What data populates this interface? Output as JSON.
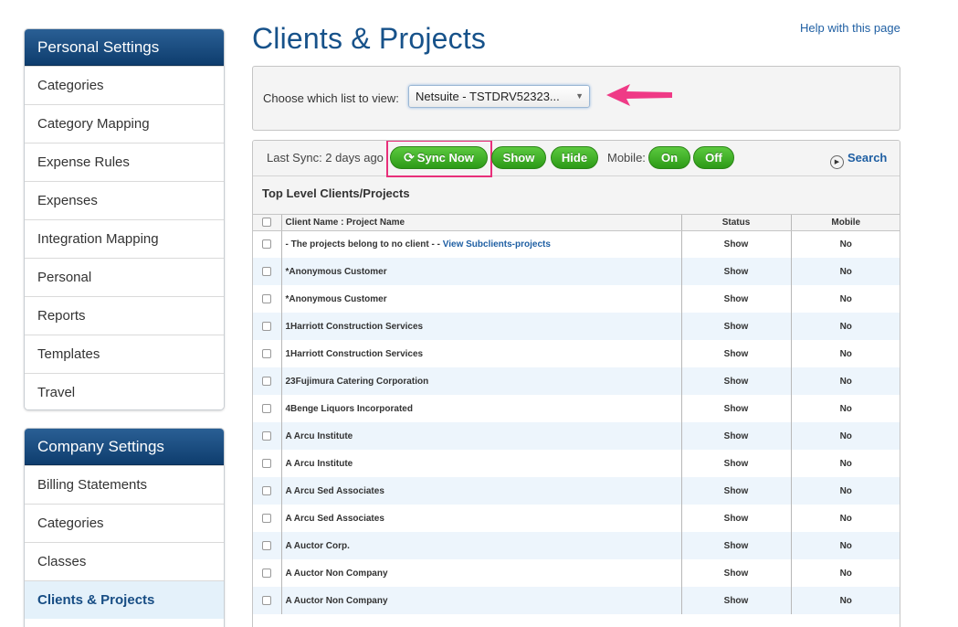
{
  "personal": {
    "title": "Personal Settings",
    "items": [
      "Categories",
      "Category Mapping",
      "Expense Rules",
      "Expenses",
      "Integration Mapping",
      "Personal",
      "Reports",
      "Templates",
      "Travel"
    ]
  },
  "company": {
    "title": "Company Settings",
    "items": [
      "Billing Statements",
      "Categories",
      "Classes",
      "Clients & Projects"
    ],
    "active": "Clients & Projects"
  },
  "header": {
    "title": "Clients & Projects",
    "help": "Help with this page"
  },
  "chooser": {
    "label": "Choose which list to view:",
    "selected": "Netsuite - TSTDRV52323..."
  },
  "toolbar": {
    "last_sync": "Last Sync: 2 days ago",
    "sync_now": "Sync Now",
    "show": "Show",
    "hide": "Hide",
    "mobile_label": "Mobile:",
    "on": "On",
    "off": "Off",
    "search": "Search"
  },
  "colors": {
    "accent": "#17528a",
    "button_green": "#2c9a17",
    "highlight": "#e8307a"
  },
  "table": {
    "section_title": "Top Level Clients/Projects",
    "headers": {
      "name": "Client Name : Project Name",
      "status": "Status",
      "mobile": "Mobile"
    },
    "first_row": {
      "name": "- The projects belong to no client - -",
      "link": "View Subclients-projects",
      "status": "Show",
      "mobile": "No"
    },
    "rows": [
      {
        "name": "*Anonymous Customer",
        "status": "Show",
        "mobile": "No"
      },
      {
        "name": "*Anonymous Customer",
        "status": "Show",
        "mobile": "No"
      },
      {
        "name": "1Harriott Construction Services",
        "status": "Show",
        "mobile": "No"
      },
      {
        "name": "1Harriott Construction Services",
        "status": "Show",
        "mobile": "No"
      },
      {
        "name": "23Fujimura Catering Corporation",
        "status": "Show",
        "mobile": "No"
      },
      {
        "name": "4Benge Liquors Incorporated",
        "status": "Show",
        "mobile": "No"
      },
      {
        "name": "A Arcu Institute",
        "status": "Show",
        "mobile": "No"
      },
      {
        "name": "A Arcu Institute",
        "status": "Show",
        "mobile": "No"
      },
      {
        "name": "A Arcu Sed Associates",
        "status": "Show",
        "mobile": "No"
      },
      {
        "name": "A Arcu Sed Associates",
        "status": "Show",
        "mobile": "No"
      },
      {
        "name": "A Auctor Corp.",
        "status": "Show",
        "mobile": "No"
      },
      {
        "name": "A Auctor Non Company",
        "status": "Show",
        "mobile": "No"
      },
      {
        "name": "A Auctor Non Company",
        "status": "Show",
        "mobile": "No"
      }
    ]
  }
}
